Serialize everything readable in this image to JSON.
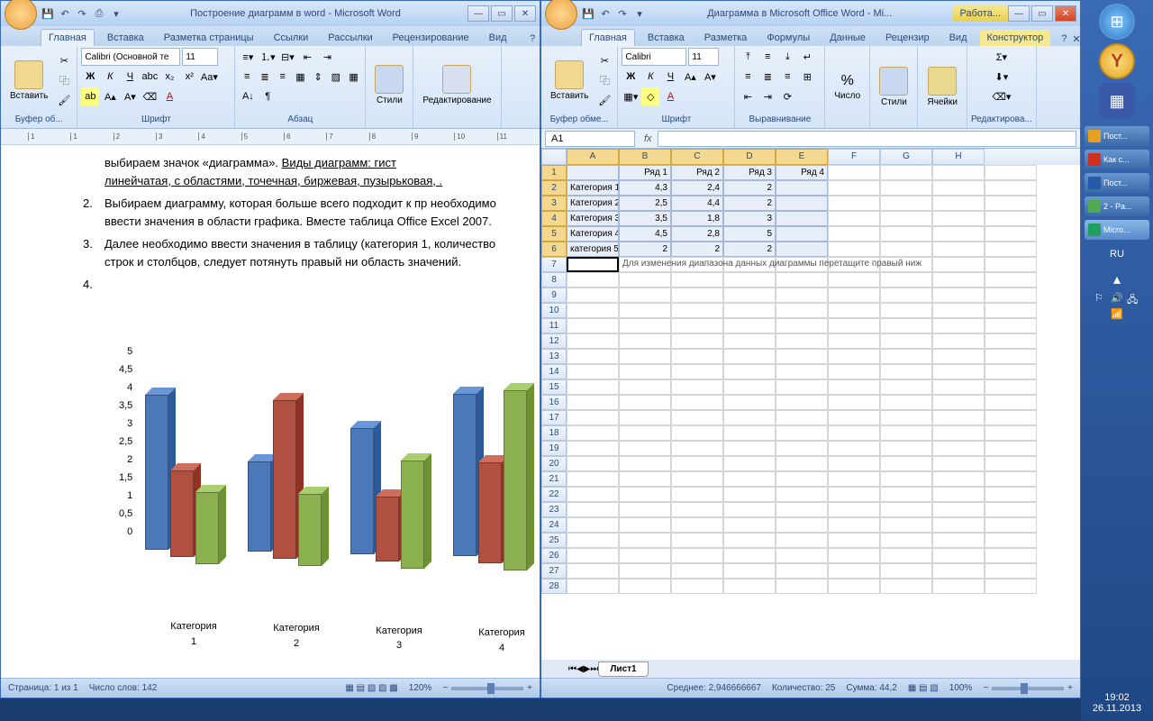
{
  "word": {
    "qat_icons": [
      "save",
      "undo",
      "redo",
      "quickprint",
      "open"
    ],
    "title": "Построение диаграмм в word - Microsoft Word",
    "tabs": [
      "Главная",
      "Вставка",
      "Разметка страницы",
      "Ссылки",
      "Рассылки",
      "Рецензирование",
      "Вид"
    ],
    "active_tab": 0,
    "ribbon": {
      "clipboard": {
        "paste": "Вставить",
        "label": "Буфер об..."
      },
      "font": {
        "name": "Calibri (Основной те",
        "size": "11",
        "label": "Шрифт"
      },
      "para": {
        "label": "Абзац"
      },
      "styles": {
        "label": "Стили"
      },
      "editing": {
        "label": "Редактирование"
      }
    },
    "doc": {
      "p1": "выбираем значок «диаграмма». ",
      "p1b": "Виды диаграмм: гист",
      "p1c": "линейчатая, с областями, точечная, биржевая, пузырьковая, .",
      "li2_num": "2.",
      "li2": "Выбираем диаграмму, которая больше всего подходит к пр необходимо ввести значения в области графика. Вместе таблица Office Excel 2007.",
      "li3_num": "3.",
      "li3": "Далее необходимо ввести значения в таблицу (категория 1, количество строк и столбцов, следует потянуть правый ни область значений.",
      "li4_num": "4."
    },
    "status": {
      "page": "Страница: 1 из 1",
      "words": "Число слов: 142",
      "zoom": "120%"
    }
  },
  "excel": {
    "qat_icons": [
      "save",
      "undo",
      "redo",
      "quickprint"
    ],
    "title": "Диаграмма в Microsoft Office Word - Mi...",
    "context_tab": "Работа...",
    "tabs": [
      "Главная",
      "Вставка",
      "Разметка",
      "Формулы",
      "Данные",
      "Рецензир",
      "Вид",
      "Конструктор"
    ],
    "active_tab": 0,
    "ribbon": {
      "clipboard": {
        "paste": "Вставить",
        "label": "Буфер обме..."
      },
      "font": {
        "name": "Calibri",
        "size": "11",
        "label": "Шрифт"
      },
      "align": {
        "label": "Выравнивание"
      },
      "number": {
        "label": "Число"
      },
      "styles": {
        "label": "Стили"
      },
      "cells": {
        "label": "Ячейки"
      },
      "editing": {
        "label": "Редактирова..."
      }
    },
    "namebox": "A1",
    "columns": [
      "A",
      "B",
      "C",
      "D",
      "E",
      "F",
      "G",
      "H"
    ],
    "headers": [
      "",
      "Ряд 1",
      "Ряд 2",
      "Ряд 3",
      "Ряд 4"
    ],
    "rows": [
      {
        "label": "Категория 1",
        "vals": [
          "4,3",
          "2,4",
          "2",
          ""
        ]
      },
      {
        "label": "Категория 2",
        "vals": [
          "2,5",
          "4,4",
          "2",
          ""
        ]
      },
      {
        "label": "Категория 3",
        "vals": [
          "3,5",
          "1,8",
          "3",
          ""
        ]
      },
      {
        "label": "Категория 4",
        "vals": [
          "4,5",
          "2,8",
          "5",
          ""
        ]
      },
      {
        "label": "категория 5",
        "vals": [
          "2",
          "2",
          "2",
          ""
        ]
      }
    ],
    "hint": "Для изменения диапазона данных диаграммы перетащите правый ниж",
    "sheet": "Лист1",
    "status": {
      "avg": "Среднее: 2,946666667",
      "count": "Количество: 25",
      "sum": "Сумма: 44,2",
      "zoom": "100%"
    }
  },
  "sidebar": {
    "tasks": [
      {
        "label": "Пост..."
      },
      {
        "label": "Как с..."
      },
      {
        "label": "Пост..."
      },
      {
        "label": "2 - Pa..."
      },
      {
        "label": "Micro..."
      }
    ],
    "lang": "RU",
    "time": "19:02",
    "date": "26.11.2013"
  },
  "chart_data": {
    "type": "bar",
    "style": "3d-clustered",
    "categories": [
      "Категория 1",
      "Категория 2",
      "Категория 3",
      "Категория 4",
      "категория 5"
    ],
    "series": [
      {
        "name": "Ряд 1",
        "values": [
          4.3,
          2.5,
          3.5,
          4.5,
          2
        ],
        "color": "#4a78b8"
      },
      {
        "name": "Ряд 2",
        "values": [
          2.4,
          4.4,
          1.8,
          2.8,
          2
        ],
        "color": "#b05040"
      },
      {
        "name": "Ряд 3",
        "values": [
          2,
          2,
          3,
          5,
          2
        ],
        "color": "#8ab050"
      },
      {
        "name": "Ряд 4",
        "values": [
          null,
          null,
          null,
          null,
          null
        ],
        "color": "#7858a8"
      }
    ],
    "ylim": [
      0,
      5
    ],
    "yticks": [
      0,
      0.5,
      1,
      1.5,
      2,
      2.5,
      3,
      3.5,
      4,
      4.5,
      5
    ],
    "xlabel": "",
    "ylabel": "",
    "title": ""
  }
}
